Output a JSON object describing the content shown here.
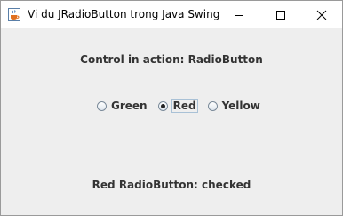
{
  "window": {
    "title": "Vi du JRadioButton trong Java Swing",
    "icon": "java-cup-icon",
    "controls": [
      "minimize-icon",
      "maximize-icon",
      "close-icon"
    ]
  },
  "content": {
    "header": "Control in action: RadioButton",
    "radios": [
      {
        "label": "Green",
        "checked": false
      },
      {
        "label": "Red",
        "checked": true,
        "focused": true
      },
      {
        "label": "Yellow",
        "checked": false
      }
    ],
    "status": "Red RadioButton: checked"
  },
  "colors": {
    "background": "#eeeeee",
    "titlebar": "#ffffff",
    "text": "#333333"
  }
}
